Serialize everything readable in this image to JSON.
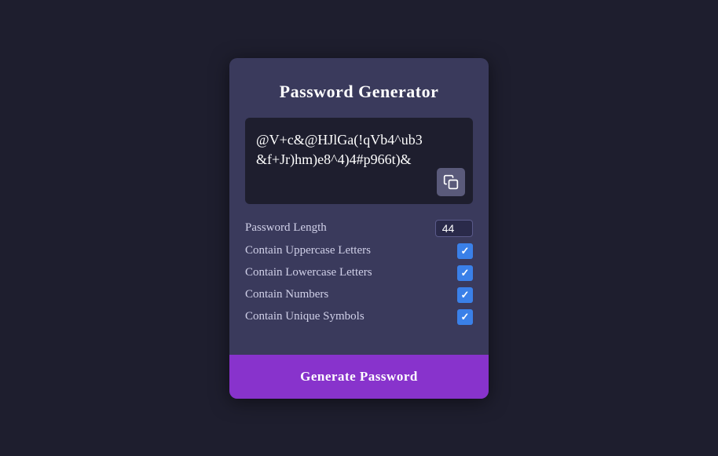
{
  "card": {
    "title": "Password Generator",
    "password": "@V+c&@HJlGa(!qVb4^ub3&f+Jr)hm)e8^4)4#p966t)&",
    "copy_icon": "⧉",
    "options": {
      "length_label": "Password Length",
      "length_value": "44",
      "uppercase_label": "Contain Uppercase Letters",
      "uppercase_checked": true,
      "lowercase_label": "Contain Lowercase Letters",
      "lowercase_checked": true,
      "numbers_label": "Contain Numbers",
      "numbers_checked": true,
      "symbols_label": "Contain Unique Symbols",
      "symbols_checked": true
    },
    "generate_label": "Generate Password"
  }
}
